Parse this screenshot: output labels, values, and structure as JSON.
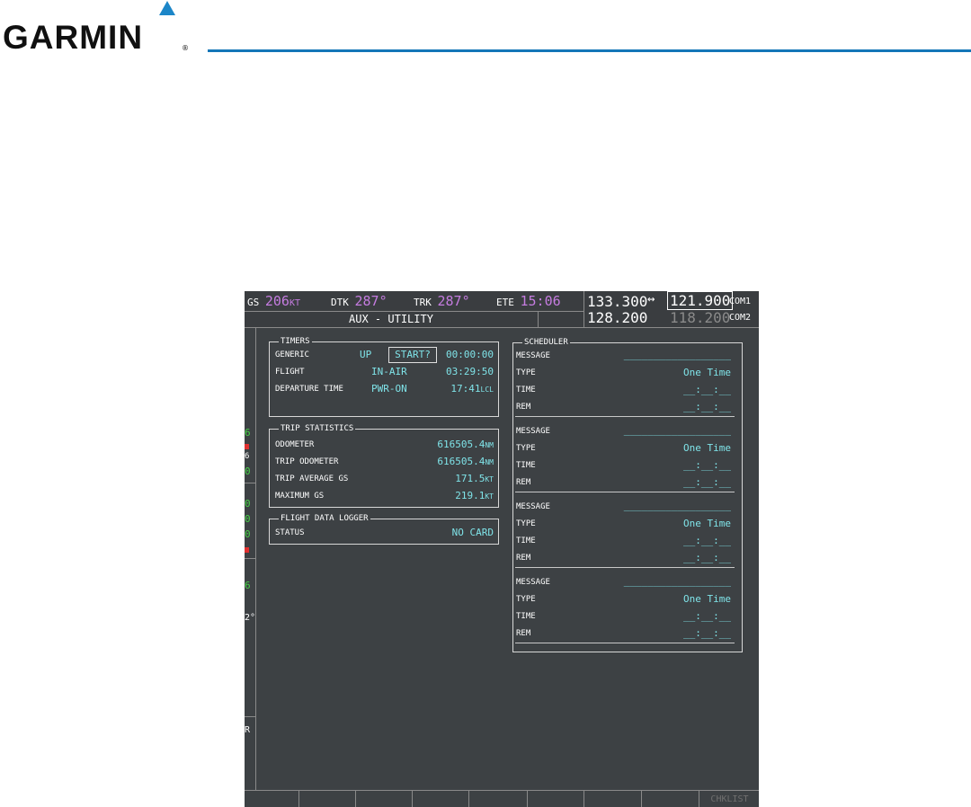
{
  "brand": {
    "name": "GARMIN",
    "reg_mark": "®",
    "accent": "#1c86c8"
  },
  "nav": {
    "gs_label": "GS",
    "gs_value": "206",
    "gs_unit": "KT",
    "dtk_label": "DTK",
    "dtk_value": "287°",
    "trk_label": "TRK",
    "trk_value": "287°",
    "ete_label": "ETE",
    "ete_value": "15:06"
  },
  "page_title": "AUX - UTILITY",
  "com": {
    "com1_active": "133.300",
    "swap_symbol": "↔",
    "com1_standby": "121.900",
    "com1_label": "COM1",
    "com2_active": "128.200",
    "com2_standby": "118.200",
    "com2_label": "COM2"
  },
  "leftstrip": {
    "c1": "6",
    "c2": "6",
    "c3": "0",
    "c4": "0",
    "c5": "0",
    "c6": "0",
    "c7": "6",
    "c8": "2°",
    "c9": "R"
  },
  "timers": {
    "title": "TIMERS",
    "generic_label": "GENERIC",
    "generic_mode": "UP",
    "generic_button": "START?",
    "generic_time": "00:00:00",
    "flight_label": "FLIGHT",
    "flight_mode": "IN-AIR",
    "flight_time": "03:29:50",
    "departure_label": "DEPARTURE TIME",
    "departure_mode": "PWR-ON",
    "departure_time": "17:41",
    "departure_unit": "LCL"
  },
  "trip": {
    "title": "TRIP STATISTICS",
    "odometer_label": "ODOMETER",
    "odometer_value": "616505.4",
    "odometer_unit": "NM",
    "trip_odometer_label": "TRIP ODOMETER",
    "trip_odometer_value": "616505.4",
    "trip_odometer_unit": "NM",
    "avg_gs_label": "TRIP AVERAGE GS",
    "avg_gs_value": "171.5",
    "avg_gs_unit": "KT",
    "max_gs_label": "MAXIMUM GS",
    "max_gs_value": "219.1",
    "max_gs_unit": "KT"
  },
  "logger": {
    "title": "FLIGHT DATA LOGGER",
    "status_label": "STATUS",
    "status_value": "NO CARD"
  },
  "scheduler": {
    "title": "SCHEDULER",
    "entries": [
      {
        "message_label": "MESSAGE",
        "message_value": "__________________",
        "type_label": "TYPE",
        "type_value": "One Time",
        "time_label": "TIME",
        "time_value": "__:__:__",
        "rem_label": "REM",
        "rem_value": "__:__:__"
      },
      {
        "message_label": "MESSAGE",
        "message_value": "__________________",
        "type_label": "TYPE",
        "type_value": "One Time",
        "time_label": "TIME",
        "time_value": "__:__:__",
        "rem_label": "REM",
        "rem_value": "__:__:__"
      },
      {
        "message_label": "MESSAGE",
        "message_value": "__________________",
        "type_label": "TYPE",
        "type_value": "One Time",
        "time_label": "TIME",
        "time_value": "__:__:__",
        "rem_label": "REM",
        "rem_value": "__:__:__"
      },
      {
        "message_label": "MESSAGE",
        "message_value": "__________________",
        "type_label": "TYPE",
        "type_value": "One Time",
        "time_label": "TIME",
        "time_value": "__:__:__",
        "rem_label": "REM",
        "rem_value": "__:__:__"
      }
    ]
  },
  "softkeys": [
    "",
    "",
    "",
    "",
    "",
    "",
    "",
    "",
    "CHKLIST"
  ]
}
